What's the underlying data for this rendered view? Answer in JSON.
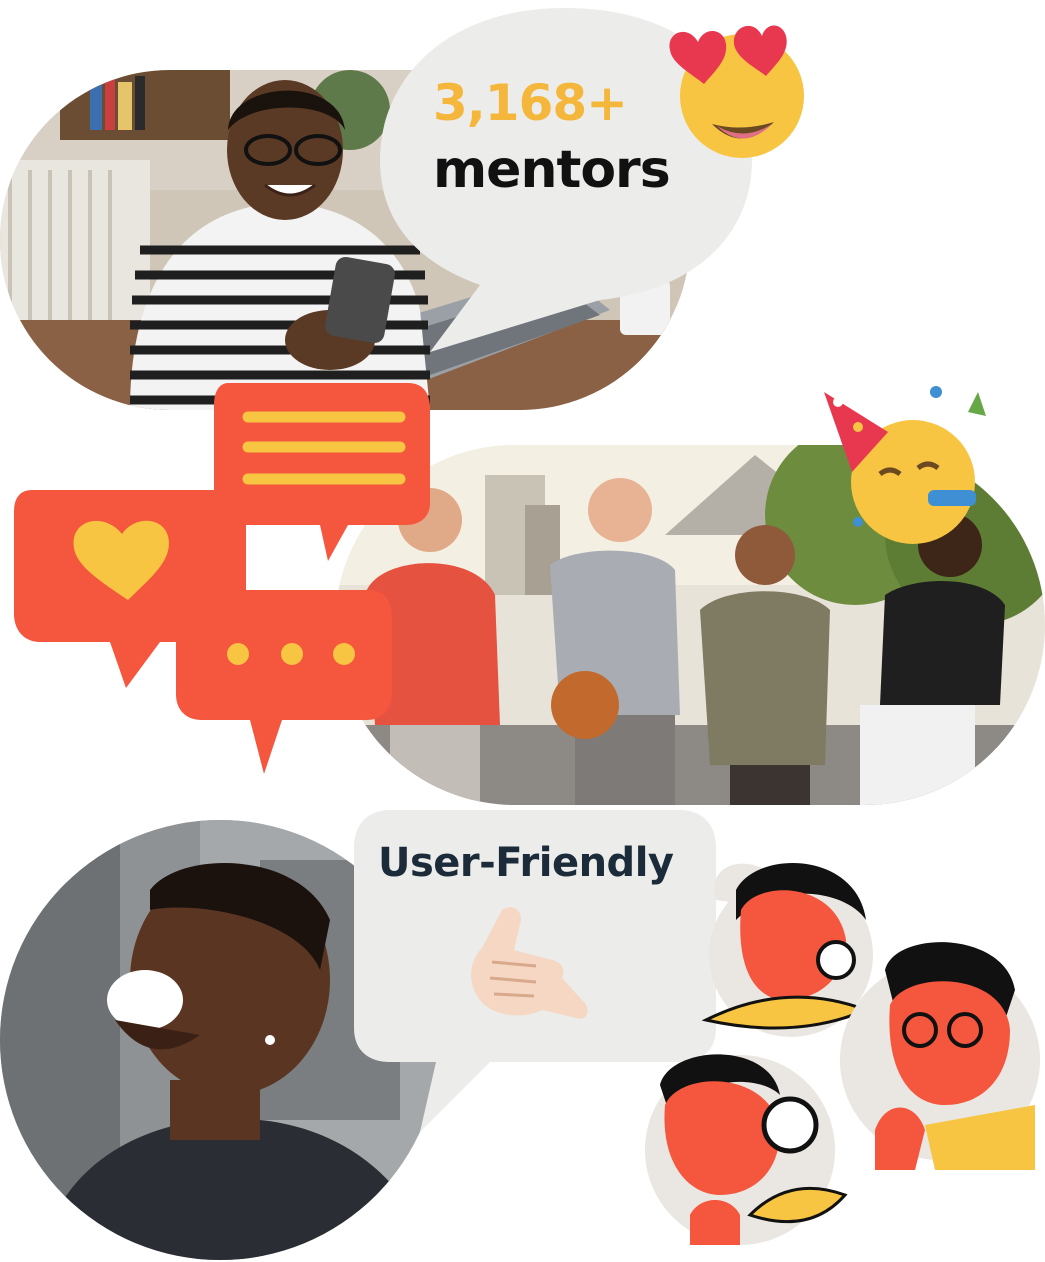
{
  "stat": {
    "count": "3,168+",
    "label": "mentors"
  },
  "feature": {
    "label": "User-Friendly"
  },
  "colors": {
    "accent_yellow": "#F5B73B",
    "text_dark": "#111111",
    "text_navy": "#1B2B3A",
    "bubble_gray": "#ECECEA",
    "chat_red": "#F4563E",
    "emoji_yellow": "#F7C542",
    "heart_red": "#E8384F"
  },
  "icons": {
    "heart_eyes": "smiling-face-with-heart-eyes-icon",
    "party": "partying-face-icon",
    "shaka": "call-me-hand-icon",
    "chat_lines": "chat-bubble-lines-icon",
    "chat_heart": "chat-bubble-heart-icon",
    "chat_dots": "chat-bubble-ellipsis-icon"
  }
}
